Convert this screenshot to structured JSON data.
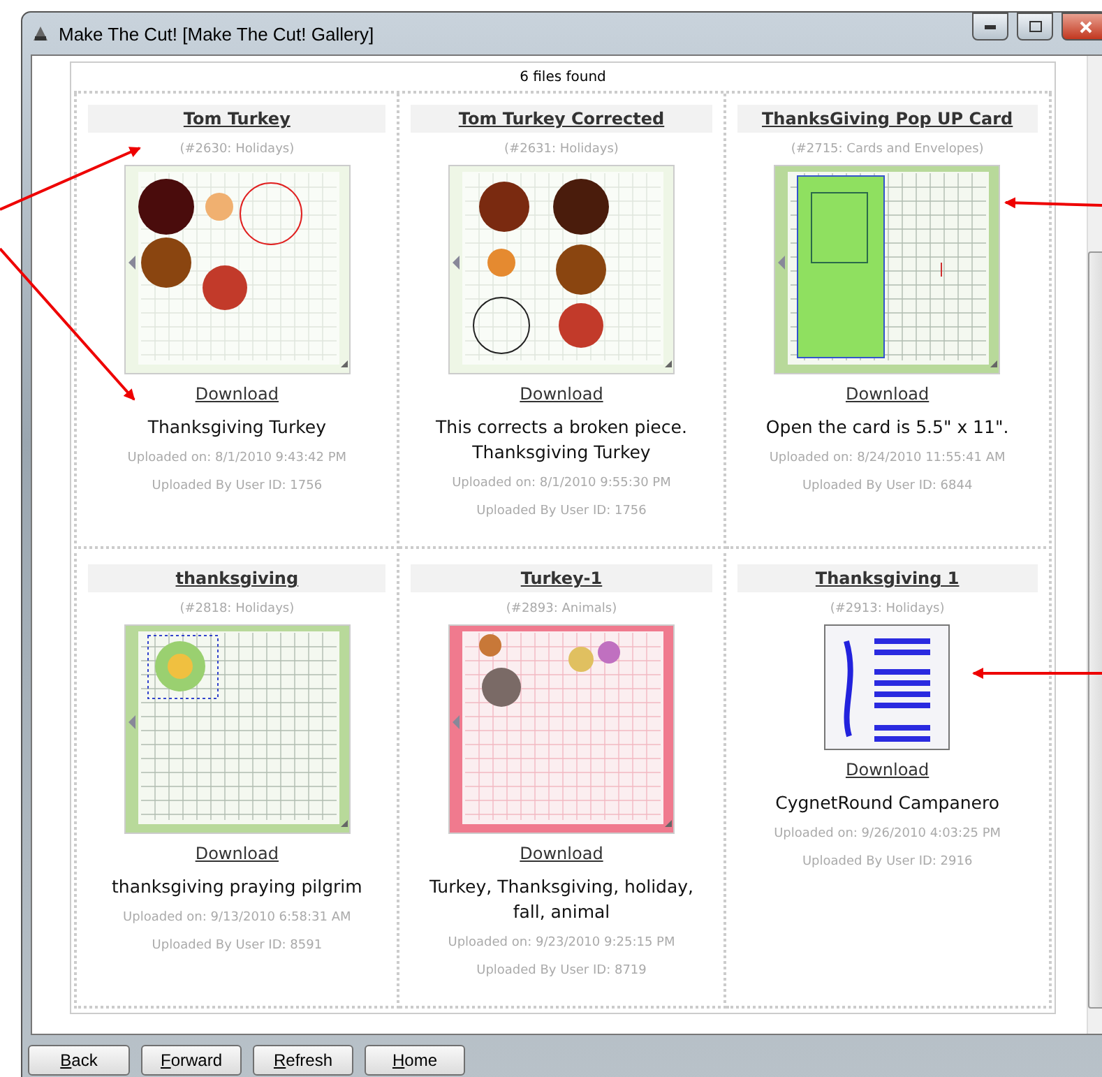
{
  "window": {
    "title": "Make The Cut! [Make The Cut! Gallery]"
  },
  "gallery": {
    "count_text": "6 files found",
    "files": [
      {
        "title": "Tom Turkey",
        "category": "(#2630: Holidays)",
        "thumbnail": {
          "kind": "light"
        },
        "download": "Download",
        "description": "Thanksgiving Turkey",
        "uploaded_on": "Uploaded on: 8/1/2010 9:43:42 PM",
        "uploaded_by": "Uploaded By User ID: 1756"
      },
      {
        "title": "Tom Turkey Corrected",
        "category": "(#2631: Holidays)",
        "thumbnail": {
          "kind": "light"
        },
        "download": "Download",
        "description": "This corrects a broken piece. Thanksgiving Turkey",
        "uploaded_on": "Uploaded on: 8/1/2010 9:55:30 PM",
        "uploaded_by": "Uploaded By User ID: 1756"
      },
      {
        "title": "ThanksGiving Pop UP Card",
        "category": "(#2715: Cards and Envelopes)",
        "thumbnail": {
          "kind": "green"
        },
        "download": "Download",
        "description": "Open the card is 5.5\" x 11\".",
        "uploaded_on": "Uploaded on: 8/24/2010 11:55:41 AM",
        "uploaded_by": "Uploaded By User ID: 6844"
      },
      {
        "title": "thanksgiving",
        "category": "(#2818: Holidays)",
        "thumbnail": {
          "kind": "green"
        },
        "download": "Download",
        "description": "thanksgiving praying pilgrim",
        "uploaded_on": "Uploaded on: 9/13/2010 6:58:31 AM",
        "uploaded_by": "Uploaded By User ID: 8591"
      },
      {
        "title": "Turkey-1",
        "category": "(#2893: Animals)",
        "thumbnail": {
          "kind": "pink"
        },
        "download": "Download",
        "description": "Turkey, Thanksgiving, holiday, fall, animal",
        "uploaded_on": "Uploaded on: 9/23/2010 9:25:15 PM",
        "uploaded_by": "Uploaded By User ID: 8719"
      },
      {
        "title": "Thanksgiving 1",
        "category": "(#2913: Holidays)",
        "thumbnail": {
          "kind": "image"
        },
        "download": "Download",
        "description": "CygnetRound Campanero",
        "uploaded_on": "Uploaded on: 9/26/2010 4:03:25 PM",
        "uploaded_by": "Uploaded By User ID: 2916"
      }
    ]
  },
  "buttons": [
    "Back",
    "Forward",
    "Refresh",
    "Home"
  ]
}
